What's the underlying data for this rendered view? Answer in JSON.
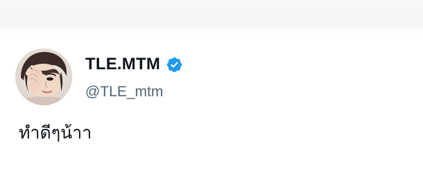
{
  "tweet": {
    "display_name": "TLE.MTM",
    "handle": "@TLE_mtm",
    "text": "ทำดีๆน้าา",
    "avatar_icon": "profile-photo",
    "verified_icon": "verified-badge-icon",
    "verified_color": "#1d9bf0"
  }
}
